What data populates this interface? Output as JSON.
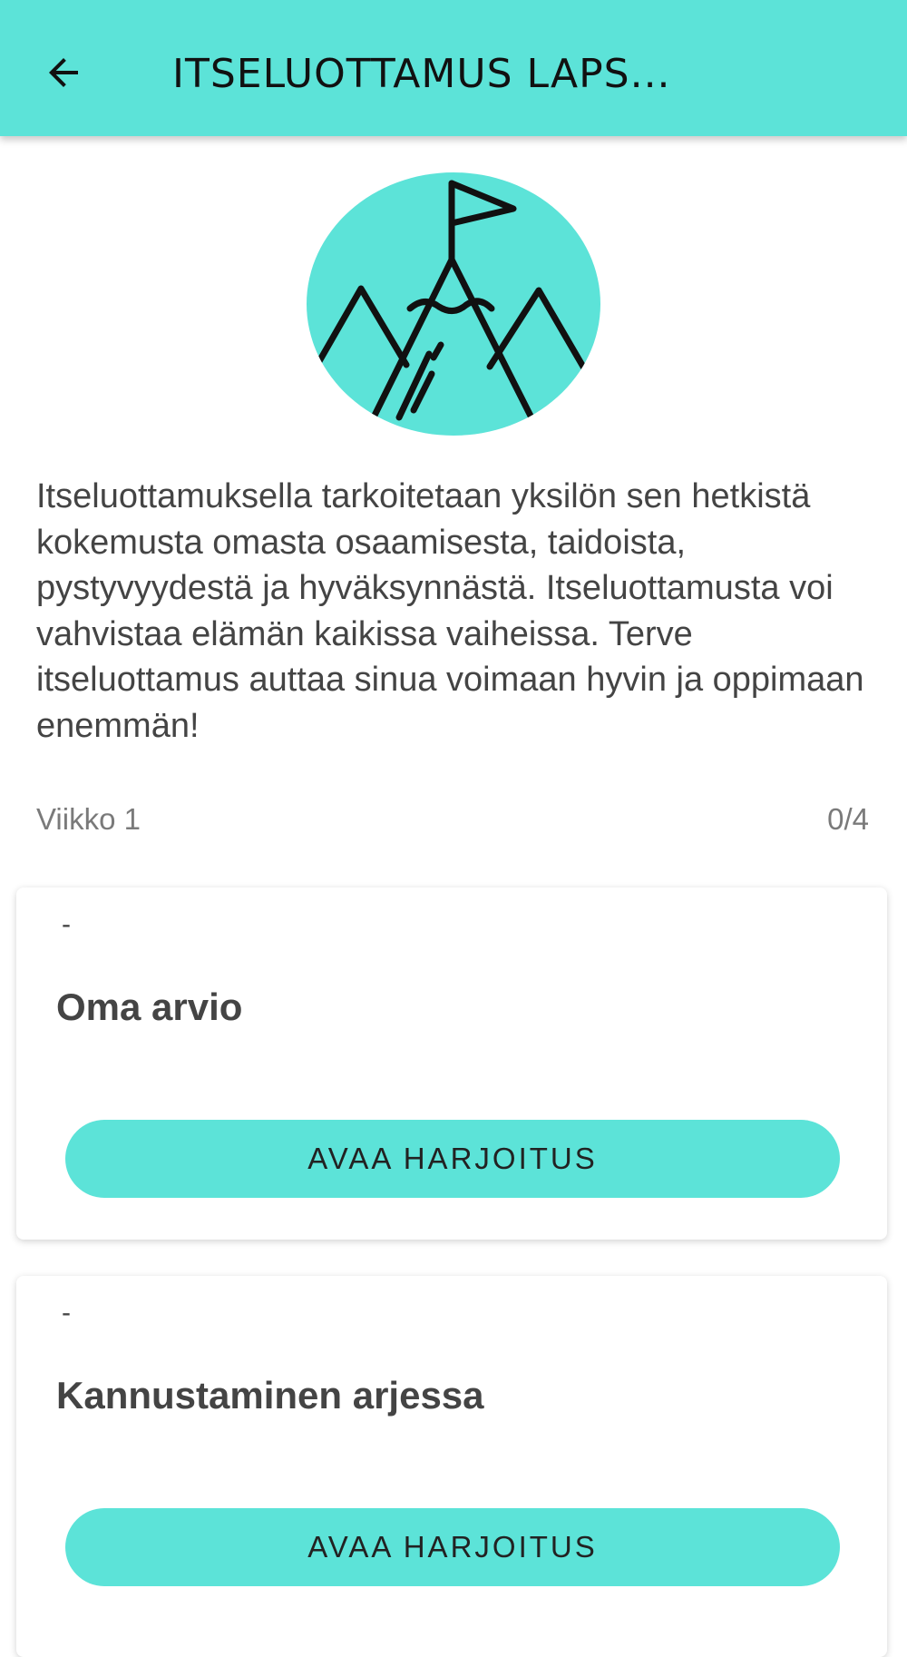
{
  "app_bar": {
    "title": "ITSELUOTTAMUS LAPS...",
    "back_icon": "arrow-left-icon",
    "background": "#5ce3d8"
  },
  "hero": {
    "icon": "mountain-flag-icon",
    "circle_color": "#5ce3d8"
  },
  "description": "Itseluottamuksella tarkoitetaan yksilön sen hetkistä kokemusta omasta osaamisesta, taidoista, pystyvyydestä ja hyväksynnästä. Itseluottamusta voi vahvistaa elämän kaikissa vaiheissa. Terve itseluottamus auttaa sinua voimaan hyvin ja oppimaan enemmän!",
  "week": {
    "label": "Viikko 1",
    "progress": "0/4"
  },
  "exercises": [
    {
      "dash": "-",
      "title": "Oma arvio",
      "button_label": "AVAA HARJOITUS"
    },
    {
      "dash": "-",
      "title": "Kannustaminen arjessa",
      "button_label": "AVAA HARJOITUS"
    }
  ]
}
